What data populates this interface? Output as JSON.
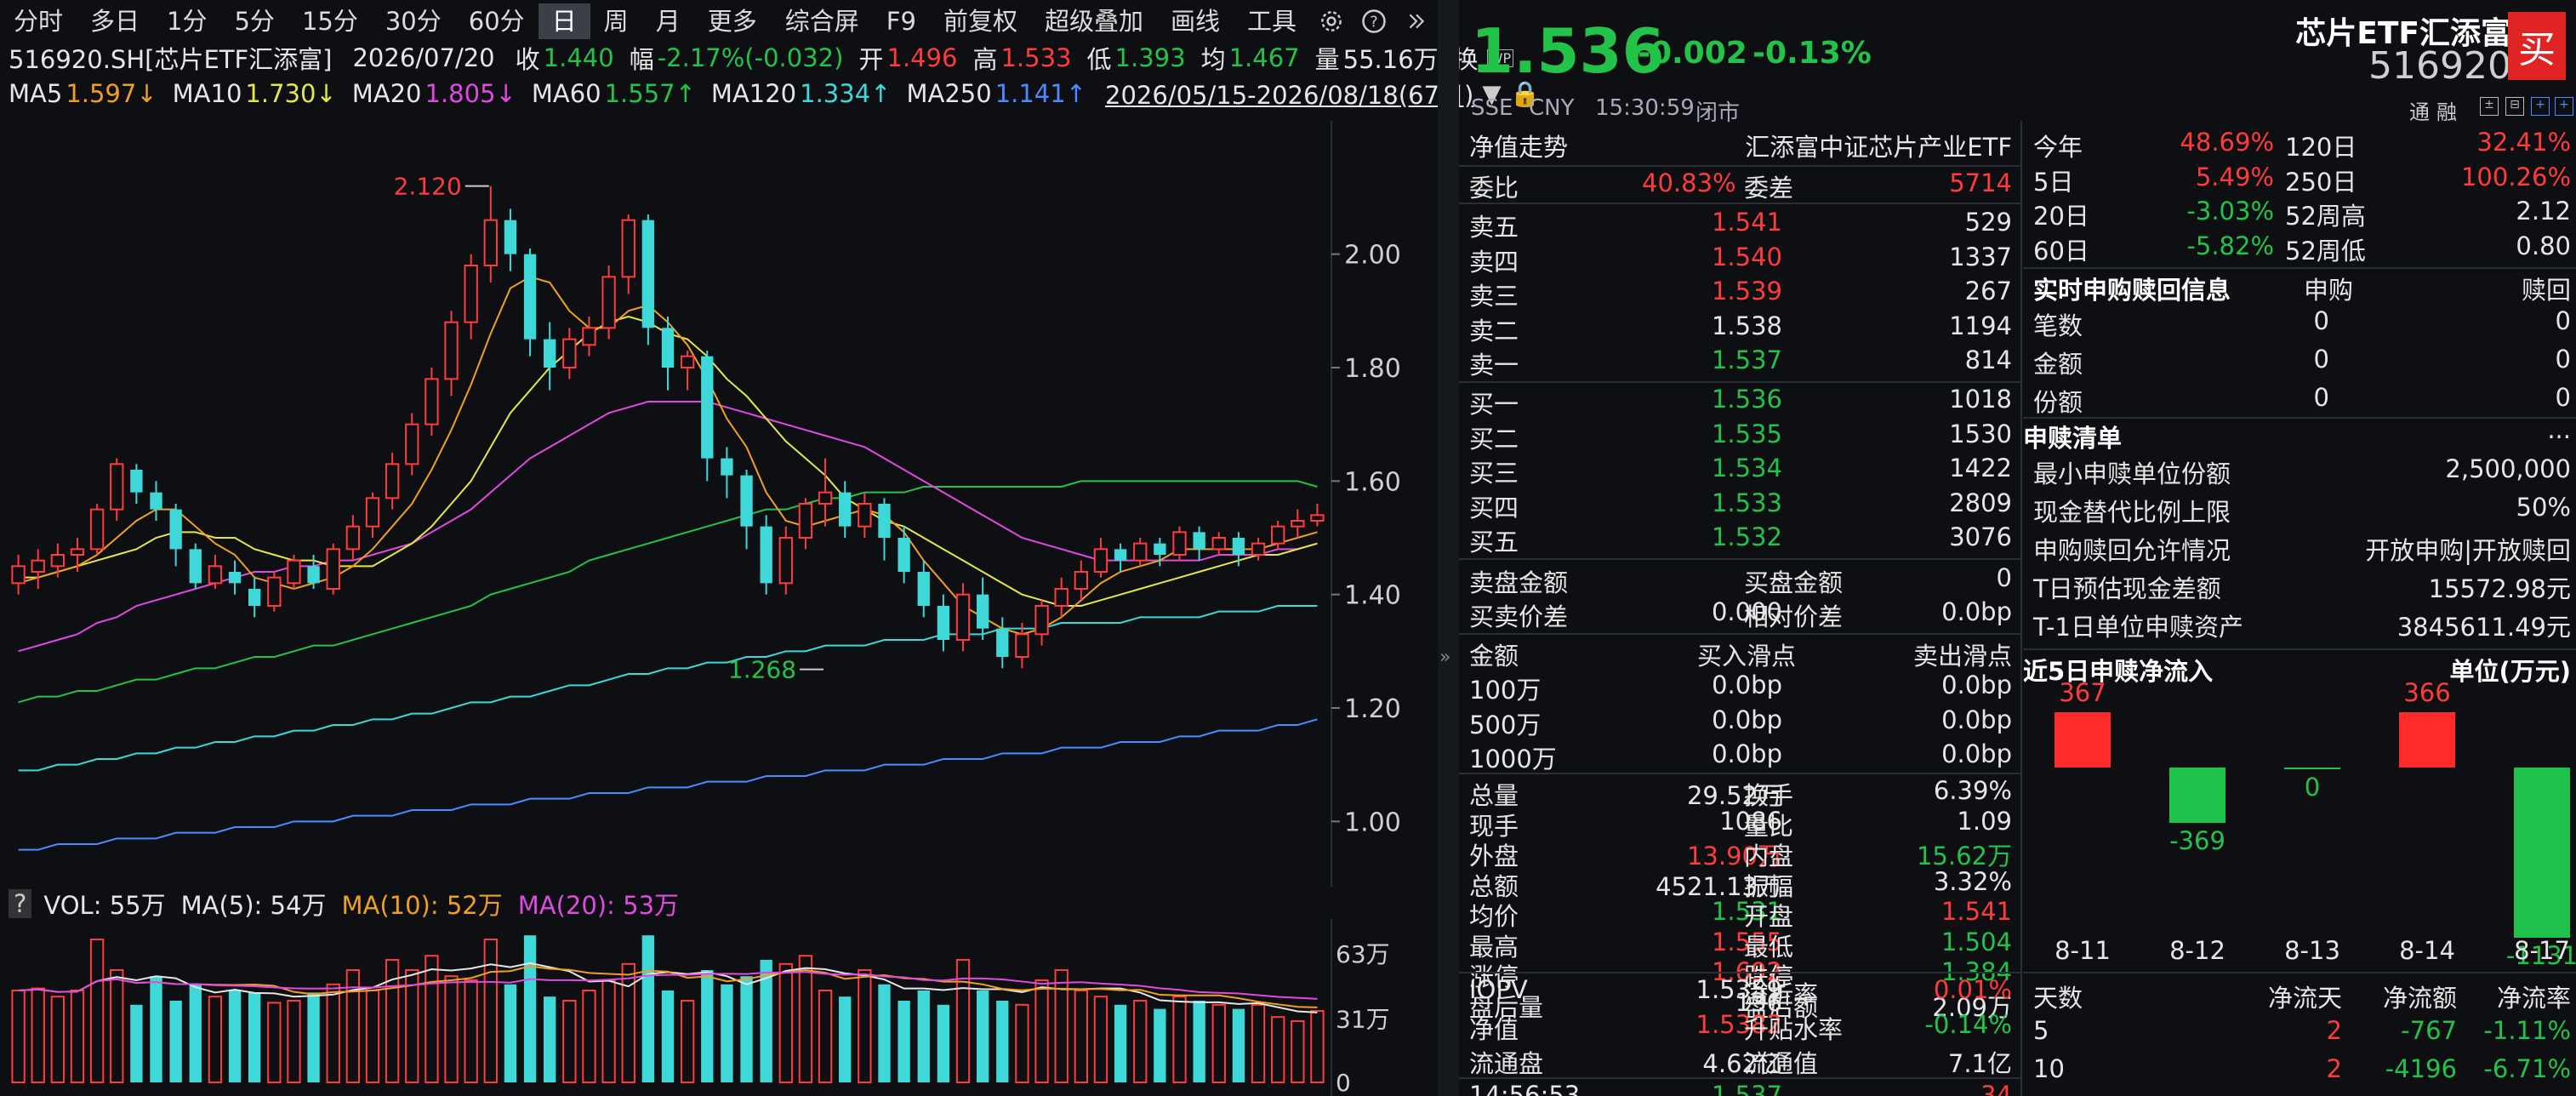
{
  "toolbar": {
    "periods": [
      "分时",
      "多日",
      "1分",
      "5分",
      "15分",
      "30分",
      "60分",
      "日",
      "周",
      "月",
      "更多"
    ],
    "active_period": "日",
    "tools": [
      "综合屏",
      "F9",
      "前复权",
      "超级叠加",
      "画线",
      "工具"
    ]
  },
  "quote_line": {
    "code": "516920.SH[芯片ETF汇添富]",
    "date": "2026/07/20",
    "close_label": "收",
    "close": "1.440",
    "amp_label": "幅",
    "amp": "-2.17%(-0.032)",
    "open_label": "开",
    "open": "1.496",
    "high_label": "高",
    "high": "1.533",
    "low_label": "低",
    "low": "1.393",
    "avg_label": "均",
    "avg": "1.467",
    "vol_label": "量",
    "vol": "55.16万",
    "turn_label": "换"
  },
  "ma_line": {
    "items": [
      {
        "label": "MA5",
        "value": "1.597↓",
        "color": "#f0a020"
      },
      {
        "label": "MA10",
        "value": "1.730↓",
        "color": "#e6e64a"
      },
      {
        "label": "MA20",
        "value": "1.805↓",
        "color": "#e04ae0"
      },
      {
        "label": "MA60",
        "value": "1.557↑",
        "color": "#23c34a"
      },
      {
        "label": "MA120",
        "value": "1.334↑",
        "color": "#3fd8d8"
      },
      {
        "label": "MA250",
        "value": "1.141↑",
        "color": "#4a8cff"
      }
    ],
    "range": "2026/05/15-2026/08/18(67日)"
  },
  "chart_data": {
    "type": "candlestick",
    "ylim": [
      0.93,
      2.22
    ],
    "yticks": [
      "2.00",
      "1.80",
      "1.60",
      "1.40",
      "1.20",
      "1.00"
    ],
    "ytick_values": [
      2.0,
      1.8,
      1.6,
      1.4,
      1.2,
      1.0
    ],
    "annotations": [
      {
        "text": "2.120",
        "value": 2.12,
        "index": 24
      },
      {
        "text": "1.268",
        "value": 1.268,
        "index": 41
      }
    ],
    "candles": [
      [
        1.42,
        1.45,
        1.4,
        1.47
      ],
      [
        1.44,
        1.46,
        1.41,
        1.48
      ],
      [
        1.45,
        1.47,
        1.43,
        1.49
      ],
      [
        1.47,
        1.48,
        1.44,
        1.5
      ],
      [
        1.48,
        1.55,
        1.47,
        1.56
      ],
      [
        1.55,
        1.63,
        1.53,
        1.64
      ],
      [
        1.62,
        1.58,
        1.56,
        1.63
      ],
      [
        1.58,
        1.55,
        1.53,
        1.6
      ],
      [
        1.55,
        1.48,
        1.45,
        1.56
      ],
      [
        1.48,
        1.42,
        1.41,
        1.49
      ],
      [
        1.42,
        1.45,
        1.41,
        1.47
      ],
      [
        1.44,
        1.42,
        1.4,
        1.46
      ],
      [
        1.41,
        1.38,
        1.36,
        1.43
      ],
      [
        1.38,
        1.43,
        1.37,
        1.44
      ],
      [
        1.42,
        1.46,
        1.41,
        1.47
      ],
      [
        1.45,
        1.42,
        1.41,
        1.47
      ],
      [
        1.41,
        1.48,
        1.4,
        1.49
      ],
      [
        1.48,
        1.52,
        1.46,
        1.54
      ],
      [
        1.52,
        1.57,
        1.5,
        1.58
      ],
      [
        1.57,
        1.63,
        1.55,
        1.65
      ],
      [
        1.63,
        1.7,
        1.61,
        1.72
      ],
      [
        1.7,
        1.78,
        1.68,
        1.8
      ],
      [
        1.78,
        1.88,
        1.75,
        1.9
      ],
      [
        1.88,
        1.98,
        1.85,
        2.0
      ],
      [
        1.98,
        2.06,
        1.95,
        2.12
      ],
      [
        2.06,
        2.0,
        1.97,
        2.08
      ],
      [
        2.0,
        1.85,
        1.82,
        2.01
      ],
      [
        1.85,
        1.8,
        1.76,
        1.88
      ],
      [
        1.8,
        1.85,
        1.78,
        1.87
      ],
      [
        1.84,
        1.87,
        1.82,
        1.89
      ],
      [
        1.87,
        1.96,
        1.85,
        1.98
      ],
      [
        1.96,
        2.06,
        1.93,
        2.07
      ],
      [
        2.06,
        1.87,
        1.84,
        2.07
      ],
      [
        1.87,
        1.8,
        1.76,
        1.89
      ],
      [
        1.8,
        1.82,
        1.76,
        1.83
      ],
      [
        1.82,
        1.64,
        1.6,
        1.83
      ],
      [
        1.64,
        1.61,
        1.57,
        1.66
      ],
      [
        1.61,
        1.52,
        1.48,
        1.62
      ],
      [
        1.52,
        1.42,
        1.4,
        1.54
      ],
      [
        1.42,
        1.5,
        1.4,
        1.52
      ],
      [
        1.5,
        1.56,
        1.48,
        1.57
      ],
      [
        1.56,
        1.58,
        1.52,
        1.64
      ],
      [
        1.58,
        1.52,
        1.5,
        1.6
      ],
      [
        1.52,
        1.56,
        1.5,
        1.58
      ],
      [
        1.56,
        1.5,
        1.46,
        1.57
      ],
      [
        1.5,
        1.44,
        1.42,
        1.52
      ],
      [
        1.44,
        1.38,
        1.36,
        1.46
      ],
      [
        1.38,
        1.32,
        1.3,
        1.4
      ],
      [
        1.32,
        1.4,
        1.3,
        1.42
      ],
      [
        1.4,
        1.34,
        1.32,
        1.43
      ],
      [
        1.34,
        1.29,
        1.27,
        1.36
      ],
      [
        1.29,
        1.33,
        1.27,
        1.35
      ],
      [
        1.33,
        1.38,
        1.31,
        1.39
      ],
      [
        1.38,
        1.41,
        1.36,
        1.43
      ],
      [
        1.41,
        1.44,
        1.39,
        1.46
      ],
      [
        1.44,
        1.48,
        1.43,
        1.5
      ],
      [
        1.48,
        1.46,
        1.44,
        1.49
      ],
      [
        1.46,
        1.49,
        1.45,
        1.5
      ],
      [
        1.49,
        1.47,
        1.45,
        1.5
      ],
      [
        1.47,
        1.51,
        1.46,
        1.52
      ],
      [
        1.51,
        1.48,
        1.46,
        1.52
      ],
      [
        1.48,
        1.5,
        1.47,
        1.51
      ],
      [
        1.5,
        1.47,
        1.45,
        1.51
      ],
      [
        1.47,
        1.49,
        1.46,
        1.5
      ],
      [
        1.49,
        1.52,
        1.48,
        1.53
      ],
      [
        1.52,
        1.53,
        1.5,
        1.55
      ],
      [
        1.53,
        1.54,
        1.52,
        1.56
      ]
    ],
    "ma5": [
      1.42,
      1.43,
      1.44,
      1.45,
      1.47,
      1.5,
      1.53,
      1.55,
      1.55,
      1.52,
      1.49,
      1.47,
      1.43,
      1.42,
      1.41,
      1.42,
      1.43,
      1.45,
      1.48,
      1.52,
      1.56,
      1.62,
      1.69,
      1.77,
      1.86,
      1.94,
      1.96,
      1.95,
      1.9,
      1.87,
      1.87,
      1.9,
      1.91,
      1.88,
      1.84,
      1.78,
      1.71,
      1.66,
      1.58,
      1.53,
      1.52,
      1.53,
      1.54,
      1.55,
      1.54,
      1.51,
      1.46,
      1.42,
      1.38,
      1.36,
      1.34,
      1.33,
      1.34,
      1.36,
      1.39,
      1.42,
      1.44,
      1.45,
      1.46,
      1.48,
      1.48,
      1.48,
      1.48,
      1.48,
      1.49,
      1.5,
      1.51
    ],
    "ma10": [
      1.43,
      1.43,
      1.44,
      1.45,
      1.46,
      1.47,
      1.48,
      1.5,
      1.51,
      1.51,
      1.5,
      1.5,
      1.48,
      1.47,
      1.46,
      1.46,
      1.45,
      1.45,
      1.45,
      1.47,
      1.49,
      1.52,
      1.56,
      1.6,
      1.66,
      1.72,
      1.76,
      1.8,
      1.83,
      1.86,
      1.88,
      1.89,
      1.88,
      1.86,
      1.85,
      1.82,
      1.78,
      1.75,
      1.71,
      1.67,
      1.64,
      1.61,
      1.57,
      1.55,
      1.53,
      1.52,
      1.5,
      1.48,
      1.46,
      1.44,
      1.42,
      1.4,
      1.39,
      1.38,
      1.38,
      1.39,
      1.4,
      1.41,
      1.42,
      1.43,
      1.44,
      1.45,
      1.46,
      1.47,
      1.47,
      1.48,
      1.49
    ],
    "ma20": [
      1.3,
      1.31,
      1.32,
      1.33,
      1.35,
      1.36,
      1.38,
      1.39,
      1.4,
      1.41,
      1.42,
      1.43,
      1.44,
      1.44,
      1.45,
      1.45,
      1.46,
      1.46,
      1.47,
      1.48,
      1.49,
      1.51,
      1.53,
      1.55,
      1.58,
      1.61,
      1.64,
      1.66,
      1.68,
      1.7,
      1.72,
      1.73,
      1.74,
      1.74,
      1.74,
      1.74,
      1.73,
      1.72,
      1.71,
      1.7,
      1.69,
      1.68,
      1.67,
      1.66,
      1.64,
      1.62,
      1.6,
      1.58,
      1.56,
      1.54,
      1.52,
      1.5,
      1.49,
      1.48,
      1.47,
      1.46,
      1.46,
      1.46,
      1.46,
      1.46,
      1.46,
      1.47,
      1.47,
      1.47,
      1.48,
      1.48,
      1.49
    ],
    "ma60": [
      1.21,
      1.22,
      1.22,
      1.23,
      1.23,
      1.24,
      1.25,
      1.25,
      1.26,
      1.27,
      1.27,
      1.28,
      1.29,
      1.29,
      1.3,
      1.31,
      1.31,
      1.32,
      1.33,
      1.34,
      1.35,
      1.36,
      1.37,
      1.38,
      1.4,
      1.41,
      1.42,
      1.43,
      1.44,
      1.46,
      1.47,
      1.48,
      1.49,
      1.5,
      1.51,
      1.52,
      1.53,
      1.54,
      1.55,
      1.55,
      1.56,
      1.57,
      1.57,
      1.58,
      1.58,
      1.58,
      1.59,
      1.59,
      1.59,
      1.59,
      1.59,
      1.59,
      1.59,
      1.59,
      1.6,
      1.6,
      1.6,
      1.6,
      1.6,
      1.6,
      1.6,
      1.6,
      1.6,
      1.6,
      1.6,
      1.6,
      1.59
    ],
    "ma120": [
      1.09,
      1.09,
      1.1,
      1.1,
      1.11,
      1.11,
      1.12,
      1.12,
      1.13,
      1.13,
      1.14,
      1.14,
      1.15,
      1.15,
      1.16,
      1.16,
      1.17,
      1.17,
      1.18,
      1.18,
      1.19,
      1.19,
      1.2,
      1.21,
      1.21,
      1.22,
      1.22,
      1.23,
      1.24,
      1.24,
      1.25,
      1.26,
      1.26,
      1.27,
      1.27,
      1.28,
      1.28,
      1.29,
      1.29,
      1.3,
      1.3,
      1.31,
      1.31,
      1.31,
      1.32,
      1.32,
      1.32,
      1.33,
      1.33,
      1.33,
      1.34,
      1.34,
      1.34,
      1.35,
      1.35,
      1.35,
      1.35,
      1.36,
      1.36,
      1.36,
      1.36,
      1.37,
      1.37,
      1.37,
      1.38,
      1.38,
      1.38
    ],
    "ma250": [
      0.95,
      0.95,
      0.96,
      0.96,
      0.96,
      0.97,
      0.97,
      0.97,
      0.98,
      0.98,
      0.98,
      0.99,
      0.99,
      0.99,
      1.0,
      1.0,
      1.0,
      1.01,
      1.01,
      1.01,
      1.02,
      1.02,
      1.02,
      1.03,
      1.03,
      1.03,
      1.04,
      1.04,
      1.04,
      1.05,
      1.05,
      1.05,
      1.06,
      1.06,
      1.06,
      1.07,
      1.07,
      1.07,
      1.08,
      1.08,
      1.08,
      1.09,
      1.09,
      1.09,
      1.1,
      1.1,
      1.1,
      1.11,
      1.11,
      1.11,
      1.12,
      1.12,
      1.12,
      1.13,
      1.13,
      1.13,
      1.14,
      1.14,
      1.14,
      1.15,
      1.15,
      1.16,
      1.16,
      1.16,
      1.17,
      1.17,
      1.18
    ],
    "volume": {
      "label": "VOL: 55万",
      "ma5": "MA(5): 54万",
      "ma10": "MA(10): 52万",
      "ma20": "MA(20): 53万",
      "yticks": [
        "63万",
        "31万",
        "0"
      ],
      "ytick_values": [
        63,
        31,
        0
      ],
      "ymax": 80,
      "values": [
        45,
        46,
        42,
        45,
        70,
        55,
        38,
        52,
        40,
        48,
        42,
        45,
        44,
        39,
        40,
        44,
        48,
        55,
        45,
        60,
        55,
        62,
        52,
        50,
        70,
        48,
        72,
        42,
        40,
        45,
        50,
        58,
        72,
        45,
        40,
        55,
        48,
        52,
        60,
        58,
        62,
        45,
        42,
        55,
        48,
        40,
        45,
        38,
        60,
        45,
        40,
        38,
        50,
        55,
        45,
        42,
        38,
        40,
        36,
        42,
        40,
        38,
        36,
        38,
        32,
        30,
        35
      ]
    }
  },
  "volume_header": {
    "question": "?"
  },
  "header": {
    "price": "1.536",
    "change": "-0.002",
    "change_pct": "-0.13%",
    "name": "芯片ETF汇添富",
    "code": "516920",
    "buy_label": "买",
    "exchange": "SSE",
    "currency": "CNY",
    "time": "15:30:59",
    "status": "闭市",
    "tags": [
      "通",
      "融"
    ]
  },
  "order_book": {
    "title": "净值走势",
    "fund_name": "汇添富中证芯片产业ETF",
    "weibi_label": "委比",
    "weibi": "40.83%",
    "weicha_label": "委差",
    "weicha": "5714",
    "asks": [
      {
        "label": "卖五",
        "price": "1.541",
        "vol": "529",
        "color": "red"
      },
      {
        "label": "卖四",
        "price": "1.540",
        "vol": "1337",
        "color": "red"
      },
      {
        "label": "卖三",
        "price": "1.539",
        "vol": "267",
        "color": "red"
      },
      {
        "label": "卖二",
        "price": "1.538",
        "vol": "1194",
        "color": "white"
      },
      {
        "label": "卖一",
        "price": "1.537",
        "vol": "814",
        "color": "green"
      }
    ],
    "bids": [
      {
        "label": "买一",
        "price": "1.536",
        "vol": "1018",
        "color": "green"
      },
      {
        "label": "买二",
        "price": "1.535",
        "vol": "1530",
        "color": "green"
      },
      {
        "label": "买三",
        "price": "1.534",
        "vol": "1422",
        "color": "green"
      },
      {
        "label": "买四",
        "price": "1.533",
        "vol": "2809",
        "color": "green"
      },
      {
        "label": "买五",
        "price": "1.532",
        "vol": "3076",
        "color": "green"
      }
    ],
    "sell_amt_label": "卖盘金额",
    "sell_amt": "-",
    "buy_amt_label": "买盘金额",
    "buy_amt": "0",
    "bid_spread_label": "买卖价差",
    "bid_spread": "0.000",
    "rel_spread_label": "相对价差",
    "rel_spread": "0.0bp"
  },
  "slippage": {
    "headers": [
      "金额",
      "买入滑点",
      "卖出滑点"
    ],
    "rows": [
      [
        "100万",
        "0.0bp",
        "0.0bp"
      ],
      [
        "500万",
        "0.0bp",
        "0.0bp"
      ],
      [
        "1000万",
        "0.0bp",
        "0.0bp"
      ]
    ]
  },
  "stats": [
    [
      {
        "l": "总量",
        "v": "29.52万",
        "c": "white"
      },
      {
        "l": "换手",
        "v": "6.39%",
        "c": "white"
      }
    ],
    [
      {
        "l": "现手",
        "v": "1086",
        "c": "white"
      },
      {
        "l": "量比",
        "v": "1.09",
        "c": "white"
      }
    ],
    [
      {
        "l": "外盘",
        "v": "13.90万",
        "c": "red"
      },
      {
        "l": "内盘",
        "v": "15.62万",
        "c": "green"
      }
    ],
    [
      {
        "l": "总额",
        "v": "4521.13万",
        "c": "white"
      },
      {
        "l": "振幅",
        "v": "3.32%",
        "c": "white"
      }
    ],
    [
      {
        "l": "均价",
        "v": "1.531",
        "c": "green"
      },
      {
        "l": "开盘",
        "v": "1.541",
        "c": "red"
      }
    ],
    [
      {
        "l": "最高",
        "v": "1.555",
        "c": "red"
      },
      {
        "l": "最低",
        "v": "1.504",
        "c": "green"
      }
    ],
    [
      {
        "l": "涨停",
        "v": "1.692",
        "c": "red"
      },
      {
        "l": "跌停",
        "v": "1.384",
        "c": "green"
      }
    ],
    [
      {
        "l": "盘后量",
        "v": "136",
        "c": "white"
      },
      {
        "l": "盘后额",
        "v": "2.09万",
        "c": "white"
      }
    ]
  ],
  "iopv": [
    [
      {
        "l": "IOPV",
        "v": "1.5359",
        "c": "white"
      },
      {
        "l": "溢折率",
        "v": "0.01%",
        "c": "red"
      }
    ],
    [
      {
        "l": "净值",
        "v": "1.5382",
        "c": "red"
      },
      {
        "l": "升贴水率",
        "v": "-0.14%",
        "c": "green"
      }
    ],
    [
      {
        "l": "流通盘",
        "v": "4.62亿",
        "c": "white"
      },
      {
        "l": "流通值",
        "v": "7.1亿",
        "c": "white"
      }
    ]
  ],
  "tick_peek": {
    "time": "14:56:53",
    "price": "1.537",
    "vol": "34"
  },
  "perf": [
    [
      {
        "l": "今年",
        "v": "48.69%",
        "c": "red"
      },
      {
        "l": "120日",
        "v": "32.41%",
        "c": "red"
      }
    ],
    [
      {
        "l": "5日",
        "v": "5.49%",
        "c": "red"
      },
      {
        "l": "250日",
        "v": "100.26%",
        "c": "red"
      }
    ],
    [
      {
        "l": "20日",
        "v": "-3.03%",
        "c": "green"
      },
      {
        "l": "52周高",
        "v": "2.12",
        "c": "white"
      }
    ],
    [
      {
        "l": "60日",
        "v": "-5.82%",
        "c": "green"
      },
      {
        "l": "52周低",
        "v": "0.80",
        "c": "white"
      }
    ]
  ],
  "realtime": {
    "title": "实时申购赎回信息",
    "col1": "申购",
    "col2": "赎回",
    "rows": [
      [
        "笔数",
        "0",
        "0"
      ],
      [
        "金额",
        "0",
        "0"
      ],
      [
        "份额",
        "0",
        "0"
      ]
    ]
  },
  "redeem_list": {
    "title": "申赎清单",
    "more": "...",
    "rows": [
      [
        "最小申赎单位份额",
        "2,500,000"
      ],
      [
        "现金替代比例上限",
        "50%"
      ],
      [
        "申购赎回允许情况",
        "开放申购|开放赎回"
      ],
      [
        "T日预估现金差额",
        "15572.98元"
      ],
      [
        "T-1日单位申赎资产",
        "3845611.49元"
      ]
    ]
  },
  "netflow": {
    "title": "近5日申赎净流入",
    "unit": "单位(万元)",
    "bars": [
      {
        "date": "8-11",
        "value": 367,
        "label": "367"
      },
      {
        "date": "8-12",
        "value": -369,
        "label": "-369"
      },
      {
        "date": "8-13",
        "value": 0,
        "label": "0"
      },
      {
        "date": "8-14",
        "value": 366,
        "label": "366"
      },
      {
        "date": "8-17",
        "value": -1131,
        "label": "-1131"
      }
    ]
  },
  "days_table": {
    "headers": [
      "天数",
      "净流天",
      "净流额",
      "净流率"
    ],
    "rows": [
      [
        "5",
        "2",
        "-767",
        "-1.11%"
      ],
      [
        "10",
        "2",
        "-4196",
        "-6.71%"
      ]
    ]
  },
  "colors": {
    "up": "#ff3b3b",
    "down": "#3fd8d8",
    "green": "#23c34a"
  }
}
